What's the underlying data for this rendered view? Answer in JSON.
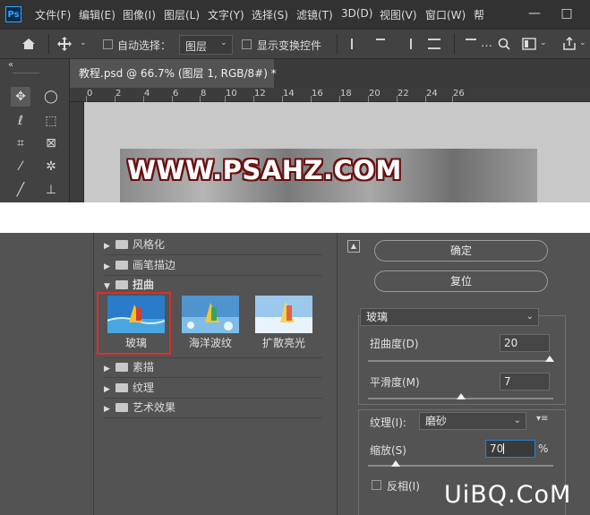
{
  "app": {
    "logo": "Ps"
  },
  "menu": [
    "文件(F)",
    "编辑(E)",
    "图像(I)",
    "图层(L)",
    "文字(Y)",
    "选择(S)",
    "滤镜(T)",
    "3D(D)",
    "视图(V)",
    "窗口(W)",
    "帮"
  ],
  "window_controls": {
    "minimize": "—",
    "maximize": "□"
  },
  "options": {
    "auto_select_label": "自动选择：",
    "layer_dropdown": "图层",
    "show_transform_label": "显示变换控件"
  },
  "document": {
    "tab_title": "教程.psd @ 66.7% (图层 1, RGB/8#) *",
    "ruler_numbers": [
      "0",
      "2",
      "4",
      "6",
      "8",
      "10",
      "12",
      "14",
      "16",
      "18",
      "20",
      "22",
      "24",
      "26"
    ],
    "image_text": "WWW.PSAHZ.COM"
  },
  "toolbar": {
    "collapse": "«"
  },
  "filter_tree": {
    "categories": [
      {
        "label": "风格化",
        "expanded": false
      },
      {
        "label": "画笔描边",
        "expanded": false
      },
      {
        "label": "扭曲",
        "expanded": true
      },
      {
        "label": "素描",
        "expanded": false
      },
      {
        "label": "纹理",
        "expanded": false
      },
      {
        "label": "艺术效果",
        "expanded": false
      }
    ],
    "thumbnails": [
      {
        "label": "玻璃",
        "selected": true
      },
      {
        "label": "海洋波纹",
        "selected": false
      },
      {
        "label": "扩散亮光",
        "selected": false
      }
    ]
  },
  "controls": {
    "ok_label": "确定",
    "reset_label": "复位",
    "filter_select": "玻璃",
    "distortion_label": "扭曲度(D)",
    "distortion_value": "20",
    "distortion_fraction": 0.98,
    "smoothness_label": "平滑度(M)",
    "smoothness_value": "7",
    "smoothness_fraction": 0.5,
    "texture_label": "纹理(I):",
    "texture_value": "磨砂",
    "scaling_label": "缩放(S)",
    "scaling_value": "70",
    "scaling_unit": "%",
    "scaling_fraction": 0.15,
    "invert_label": "反相(I)"
  },
  "watermark": "UiBQ.CoM",
  "colors": {
    "selection_border": "#d9302c",
    "accent_blue": "#31a8ff"
  }
}
